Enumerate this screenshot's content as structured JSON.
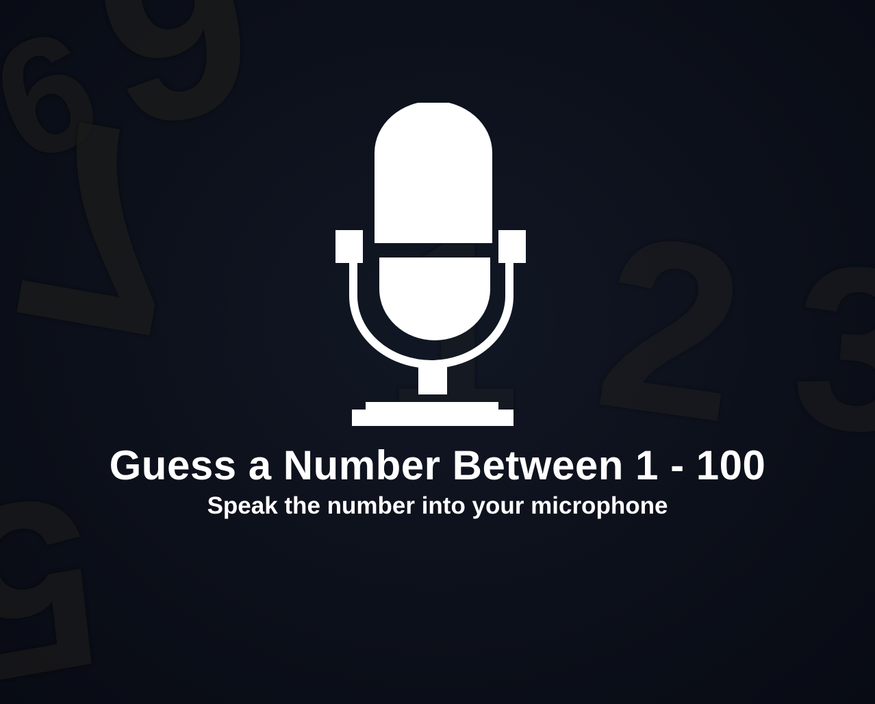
{
  "game": {
    "title": "Guess a Number Between 1 - 100",
    "subtitle": "Speak the number into your microphone",
    "icon": "microphone-icon"
  },
  "background": {
    "digits": [
      "9",
      "9",
      "7",
      "5",
      "2",
      "3",
      "1"
    ]
  },
  "colors": {
    "background": "#0d111b",
    "text": "#ffffff",
    "icon": "#ffffff"
  }
}
